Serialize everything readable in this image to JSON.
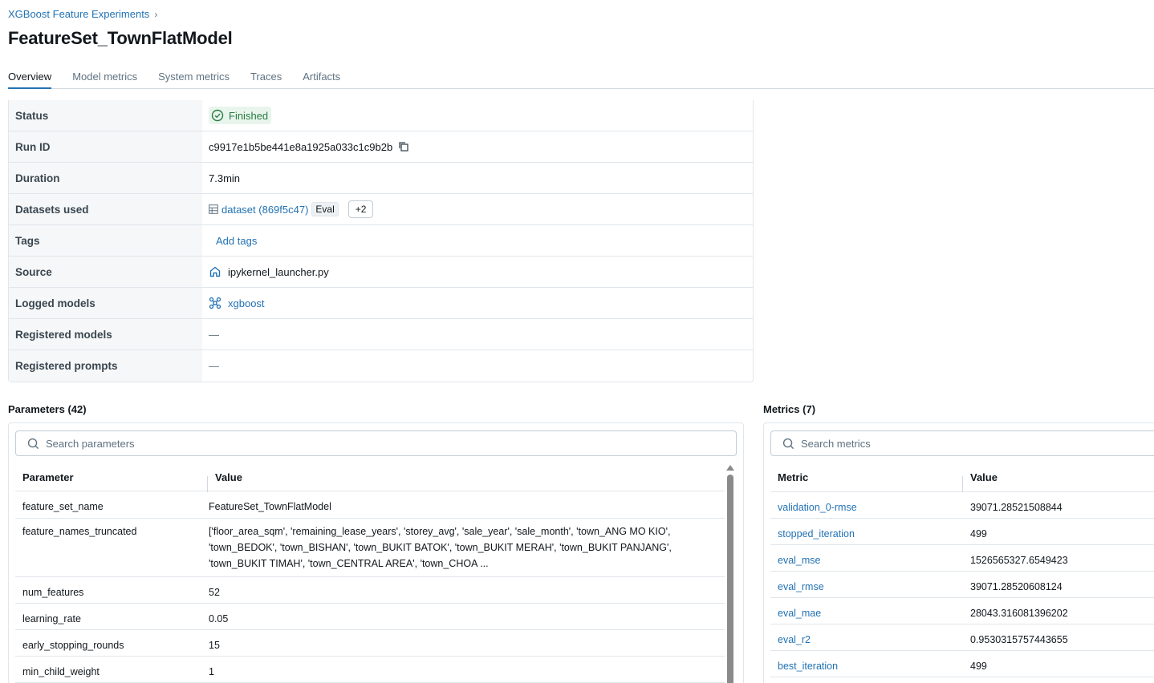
{
  "breadcrumb": {
    "experiment": "XGBoost Feature Experiments",
    "separator": "›"
  },
  "title": "FeatureSet_TownFlatModel",
  "tabs": [
    {
      "label": "Overview",
      "active": true
    },
    {
      "label": "Model metrics",
      "active": false
    },
    {
      "label": "System metrics",
      "active": false
    },
    {
      "label": "Traces",
      "active": false
    },
    {
      "label": "Artifacts",
      "active": false
    }
  ],
  "overview": {
    "status": {
      "label": "Status",
      "value": "Finished",
      "icon": "check-circle-icon"
    },
    "run_id": {
      "label": "Run ID",
      "value": "c9917e1b5be441e8a1925a033c1c9b2b",
      "icon": "copy-icon"
    },
    "duration": {
      "label": "Duration",
      "value": "7.3min"
    },
    "datasets": {
      "label": "Datasets used",
      "name": "dataset (869f5c47)",
      "tag": "Eval",
      "more": "+2",
      "icon": "table-icon"
    },
    "tags": {
      "label": "Tags",
      "action": "Add tags"
    },
    "source": {
      "label": "Source",
      "value": "ipykernel_launcher.py",
      "icon": "home-icon"
    },
    "logged_models": {
      "label": "Logged models",
      "value": "xgboost",
      "icon": "models-icon"
    },
    "registered_models": {
      "label": "Registered models",
      "value": "—"
    },
    "registered_prompts": {
      "label": "Registered prompts",
      "value": "—"
    }
  },
  "parameters": {
    "title": "Parameters (42)",
    "search_placeholder": "Search parameters",
    "columns": [
      "Parameter",
      "Value"
    ],
    "rows": [
      {
        "name": "feature_set_name",
        "value": "FeatureSet_TownFlatModel"
      },
      {
        "name": "feature_names_truncated",
        "value": "['floor_area_sqm', 'remaining_lease_years', 'storey_avg', 'sale_year', 'sale_month', 'town_ANG MO KIO', 'town_BEDOK', 'town_BISHAN', 'town_BUKIT BATOK', 'town_BUKIT MERAH', 'town_BUKIT PANJANG', 'town_BUKIT TIMAH', 'town_CENTRAL AREA', 'town_CHOA ..."
      },
      {
        "name": "num_features",
        "value": "52"
      },
      {
        "name": "learning_rate",
        "value": "0.05"
      },
      {
        "name": "early_stopping_rounds",
        "value": "15"
      },
      {
        "name": "min_child_weight",
        "value": "1"
      }
    ]
  },
  "metrics": {
    "title": "Metrics (7)",
    "search_placeholder": "Search metrics",
    "columns": [
      "Metric",
      "Value"
    ],
    "rows": [
      {
        "name": "validation_0-rmse",
        "value": "39071.28521508844"
      },
      {
        "name": "stopped_iteration",
        "value": "499"
      },
      {
        "name": "eval_mse",
        "value": "1526565327.6549423"
      },
      {
        "name": "eval_rmse",
        "value": "39071.28520608124"
      },
      {
        "name": "eval_mae",
        "value": "28043.316081396202"
      },
      {
        "name": "eval_r2",
        "value": "0.9530315757443655"
      },
      {
        "name": "best_iteration",
        "value": "499"
      }
    ]
  },
  "colors": {
    "link": "#2272b4",
    "success": "#277c43",
    "border": "#e0e6eb"
  }
}
